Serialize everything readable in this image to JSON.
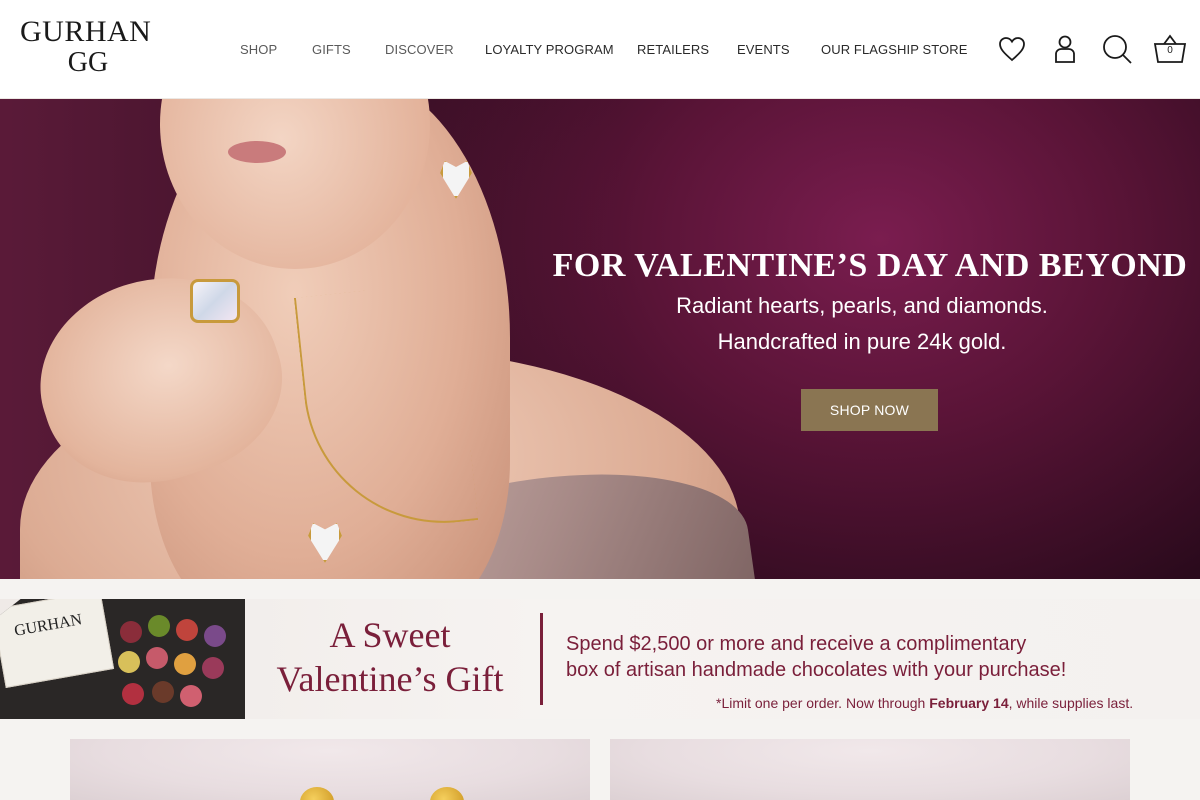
{
  "brand": {
    "name": "GURHAN",
    "monogram": "GG"
  },
  "nav": {
    "items": [
      {
        "label": "SHOP"
      },
      {
        "label": "GIFTS"
      },
      {
        "label": "DISCOVER"
      },
      {
        "label": "LOYALTY PROGRAM"
      },
      {
        "label": "RETAILERS"
      },
      {
        "label": "EVENTS"
      },
      {
        "label": "OUR FLAGSHIP STORE"
      }
    ]
  },
  "header_icons": {
    "wishlist": "heart-icon",
    "account": "user-icon",
    "search": "search-icon",
    "cart": "basket-icon",
    "cart_count": "0"
  },
  "hero": {
    "title": "FOR VALENTINE’S DAY AND BEYOND",
    "subtitle_line1": "Radiant hearts, pearls, and diamonds.",
    "subtitle_line2": "Handcrafted in pure 24k gold.",
    "cta_label": "SHOP NOW"
  },
  "promo": {
    "box_label": "GURHAN",
    "heading_line1": "A Sweet",
    "heading_line2": "Valentine’s Gift",
    "text_line1": "Spend $2,500 or more and receive a complimentary",
    "text_line2": "box of artisan handmade chocolates with your purchase!",
    "fine_print_prefix": "*Limit one per order. Now through ",
    "fine_print_date": "February 14",
    "fine_print_suffix": ", while supplies last."
  },
  "colors": {
    "accent_cta": "#8a7552",
    "promo_text": "#7a1f3a",
    "hero_bg": "#5a1437"
  }
}
